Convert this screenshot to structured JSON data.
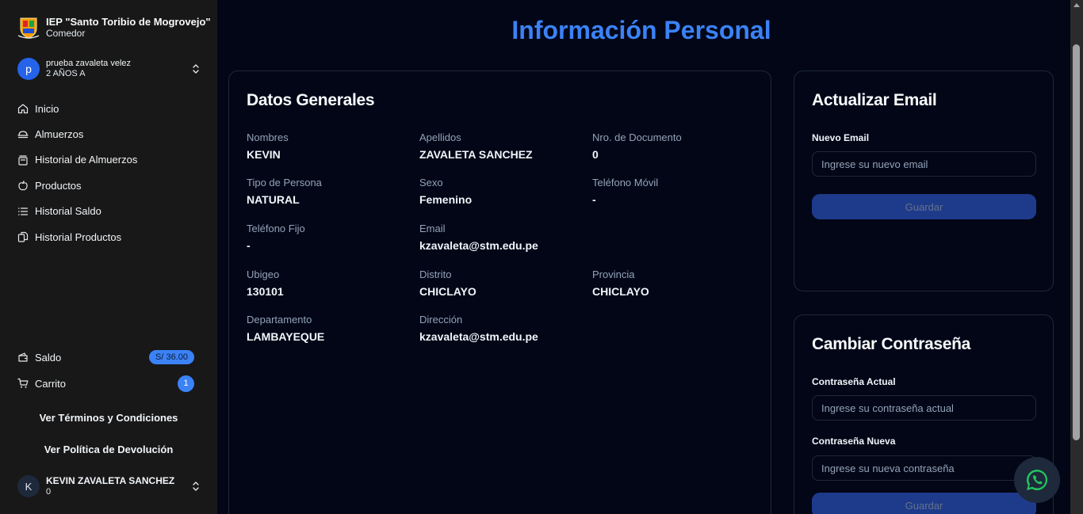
{
  "colors": {
    "accent": "#3b82f6",
    "sidebar_bg": "#181818",
    "page_bg": "#020617",
    "button_bg": "#1e3a8a",
    "whatsapp": "#22c55e"
  },
  "sidebar": {
    "brand": {
      "title": "IEP \"Santo Toribio de Mogrovejo\"",
      "subtitle": "Comedor",
      "logo_icon": "school-crest-icon"
    },
    "student": {
      "initial": "p",
      "name": "prueba zavaleta velez",
      "grade": "2 AÑOS A"
    },
    "nav": [
      {
        "label": "Inicio",
        "icon": "home-icon"
      },
      {
        "label": "Almuerzos",
        "icon": "lunch-icon"
      },
      {
        "label": "Historial de Almuerzos",
        "icon": "history-icon"
      },
      {
        "label": "Productos",
        "icon": "apple-icon"
      },
      {
        "label": "Historial Saldo",
        "icon": "list-icon"
      },
      {
        "label": "Historial Productos",
        "icon": "files-icon"
      }
    ],
    "saldo": {
      "label": "Saldo",
      "value": "S/ 36.00"
    },
    "carrito": {
      "label": "Carrito",
      "count": "1"
    },
    "links": {
      "terms": "Ver Términos y Condiciones",
      "policy": "Ver Política de Devolución"
    },
    "user": {
      "initial": "K",
      "name": "KEVIN ZAVALETA SANCHEZ",
      "sub": "0"
    }
  },
  "main": {
    "title": "Información Personal",
    "general": {
      "title": "Datos Generales",
      "fields": [
        {
          "label": "Nombres",
          "value": "KEVIN"
        },
        {
          "label": "Apellidos",
          "value": "ZAVALETA SANCHEZ"
        },
        {
          "label": "Nro. de Documento",
          "value": "0"
        },
        {
          "label": "Tipo de Persona",
          "value": "NATURAL"
        },
        {
          "label": "Sexo",
          "value": "Femenino"
        },
        {
          "label": "Teléfono Móvil",
          "value": "-"
        },
        {
          "label": "Teléfono Fijo",
          "value": "-"
        },
        {
          "label": "Email",
          "value": "kzavaleta@stm.edu.pe"
        },
        {
          "label": "Ubigeo",
          "value": "130101"
        },
        {
          "label": "Distrito",
          "value": "CHICLAYO"
        },
        {
          "label": "Provincia",
          "value": "CHICLAYO"
        },
        {
          "label": "Departamento",
          "value": "LAMBAYEQUE"
        },
        {
          "label": "Dirección",
          "value": "kzavaleta@stm.edu.pe"
        }
      ]
    },
    "email_card": {
      "title": "Actualizar Email",
      "label": "Nuevo Email",
      "placeholder": "Ingrese su nuevo email",
      "button": "Guardar"
    },
    "password_card": {
      "title": "Cambiar Contraseña",
      "current_label": "Contraseña Actual",
      "current_placeholder": "Ingrese su contraseña actual",
      "new_label": "Contraseña Nueva",
      "new_placeholder": "Ingrese su nueva contraseña",
      "button": "Guardar"
    }
  },
  "whatsapp": {
    "icon": "whatsapp-icon"
  }
}
